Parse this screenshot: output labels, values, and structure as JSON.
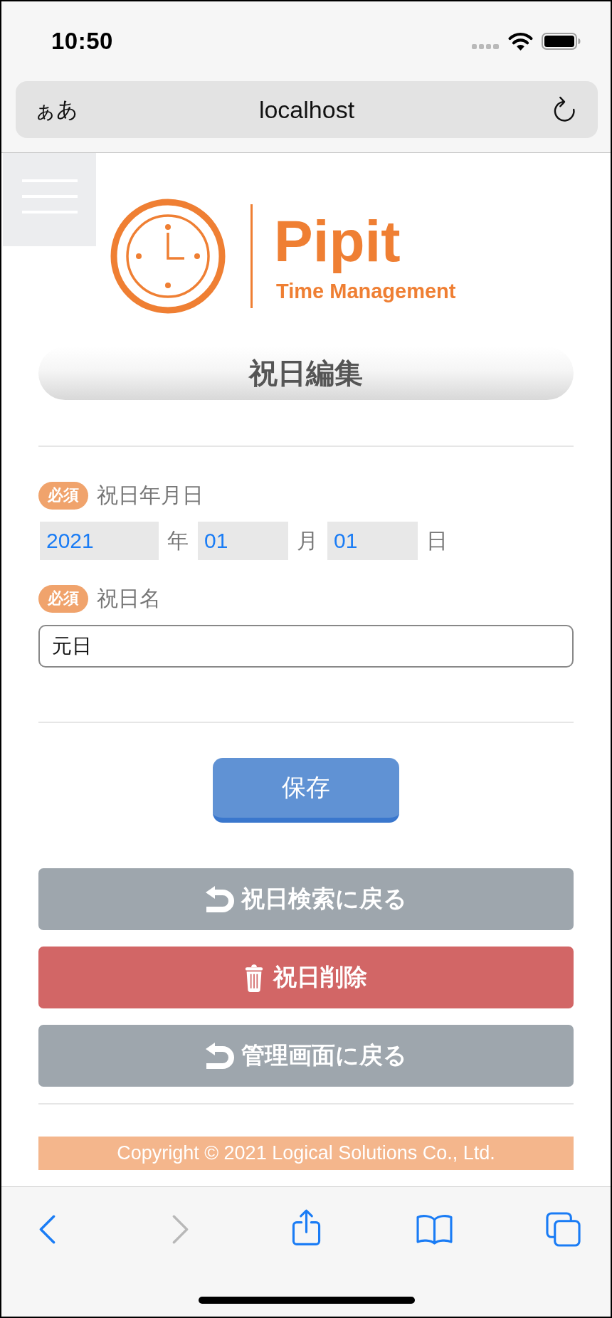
{
  "status_bar": {
    "time": "10:50"
  },
  "address_bar": {
    "text_size_button": "ぁあ",
    "url": "localhost"
  },
  "logo": {
    "name": "Pipit",
    "tagline": "Time Management"
  },
  "page_title": "祝日編集",
  "form": {
    "fields": [
      {
        "kind": "date",
        "badge": "必須",
        "label": "祝日年月日",
        "parts": [
          {
            "value": "2021",
            "unit": "年"
          },
          {
            "value": "01",
            "unit": "月"
          },
          {
            "value": "01",
            "unit": "日"
          }
        ]
      },
      {
        "kind": "text",
        "badge": "必須",
        "label": "祝日名",
        "value": "元日"
      }
    ]
  },
  "save_button": "保存",
  "action_buttons": [
    {
      "kind": "back",
      "label": "祝日検索に戻る"
    },
    {
      "kind": "delete",
      "label": "祝日削除"
    },
    {
      "kind": "back",
      "label": "管理画面に戻る"
    }
  ],
  "footer": {
    "copyright": "Copyright © 2021 Logical Solutions Co., Ltd."
  },
  "toolbar": [
    {
      "kind": "back",
      "disabled": false
    },
    {
      "kind": "forward",
      "disabled": true
    },
    {
      "kind": "share",
      "disabled": false
    },
    {
      "kind": "bookmarks",
      "disabled": false
    },
    {
      "kind": "tabs",
      "disabled": false
    }
  ]
}
